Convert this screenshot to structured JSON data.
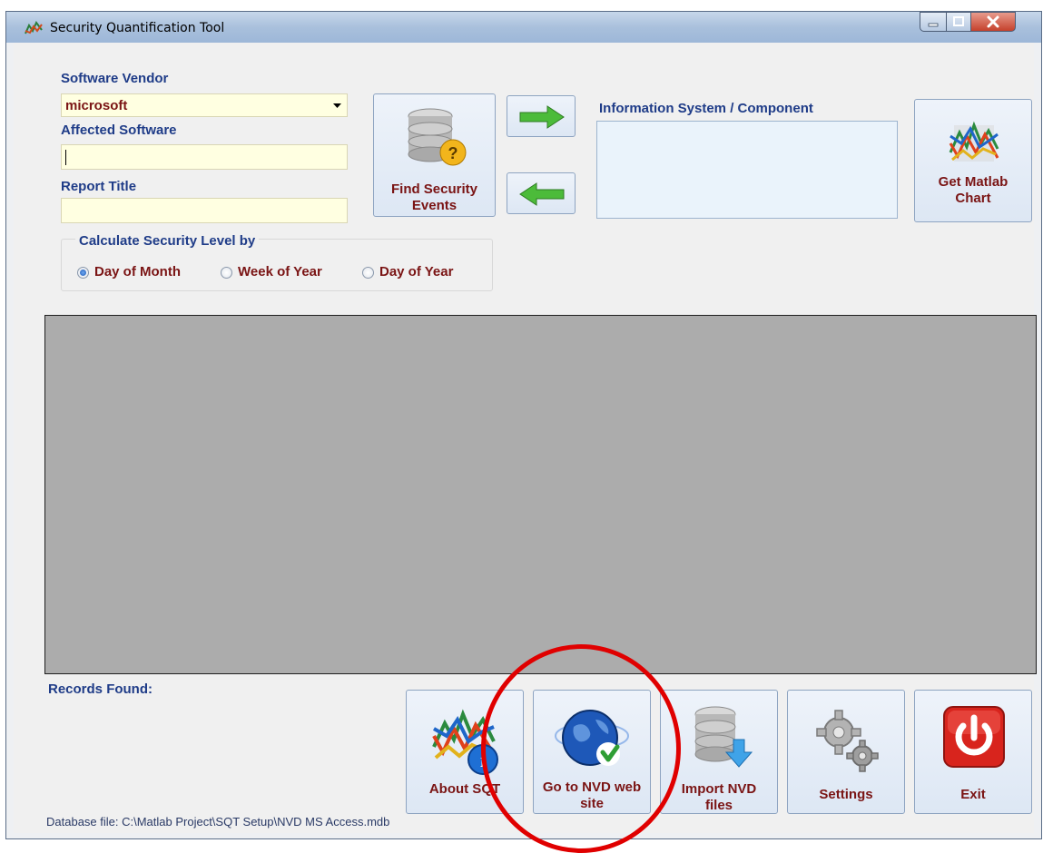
{
  "window": {
    "title": "Security Quantification Tool",
    "icons": {
      "app": "matlab-chart-icon",
      "minimize": "minimize-icon",
      "maximize": "maximize-icon",
      "close": "close-icon"
    }
  },
  "form": {
    "vendor_label": "Software Vendor",
    "vendor_value": "microsoft",
    "affected_label": "Affected Software",
    "affected_value": "",
    "report_label": "Report Title",
    "report_value": "",
    "info_system_label": "Information System / Component"
  },
  "buttons": {
    "find_events": "Find Security Events",
    "get_chart": "Get Matlab Chart",
    "about": "About SQT",
    "nvd_site": "Go to NVD web site",
    "import_nvd": "Import NVD files",
    "settings": "Settings",
    "exit": "Exit"
  },
  "calc": {
    "group_label": "Calculate Security Level by",
    "options": [
      "Day of Month",
      "Week of Year",
      "Day of Year"
    ],
    "selected": "Day of Month"
  },
  "status": {
    "records_label": "Records Found:",
    "db_file": "Database file: C:\\Matlab Project\\SQT Setup\\NVD MS Access.mdb"
  },
  "colors": {
    "label_blue": "#1f3c88",
    "label_dark_red": "#7a1414",
    "input_yellow": "#ffffe1",
    "panel_gray": "#acacac",
    "annotation_red": "#e00000"
  }
}
